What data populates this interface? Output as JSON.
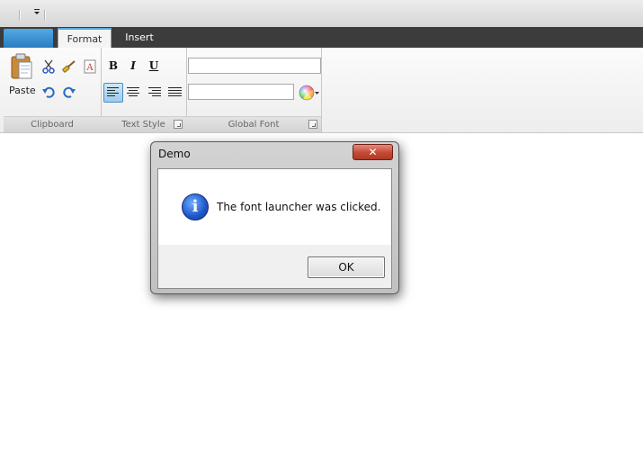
{
  "ribbon": {
    "tabs": [
      {
        "label": "Format",
        "active": true
      },
      {
        "label": "Insert",
        "active": false
      }
    ],
    "groups": {
      "clipboard": {
        "label": "Clipboard",
        "paste_label": "Paste"
      },
      "text_style": {
        "label": "Text Style",
        "bold": "B",
        "italic": "I",
        "underline": "U"
      },
      "global_font": {
        "label": "Global Font",
        "font_name_value": "",
        "font_size_value": ""
      }
    },
    "icons": [
      "paste-icon",
      "cut-icon",
      "format-painter-icon",
      "clear-format-icon",
      "undo-icon",
      "redo-icon",
      "align-left-icon",
      "align-center-icon",
      "align-right-icon",
      "justify-icon",
      "color-wheel-icon"
    ],
    "accent": "#2a7cc2"
  },
  "dialog": {
    "title": "Demo",
    "close_glyph": "✕",
    "message": "The font launcher was clicked.",
    "info_glyph": "i",
    "ok_label": "OK"
  }
}
